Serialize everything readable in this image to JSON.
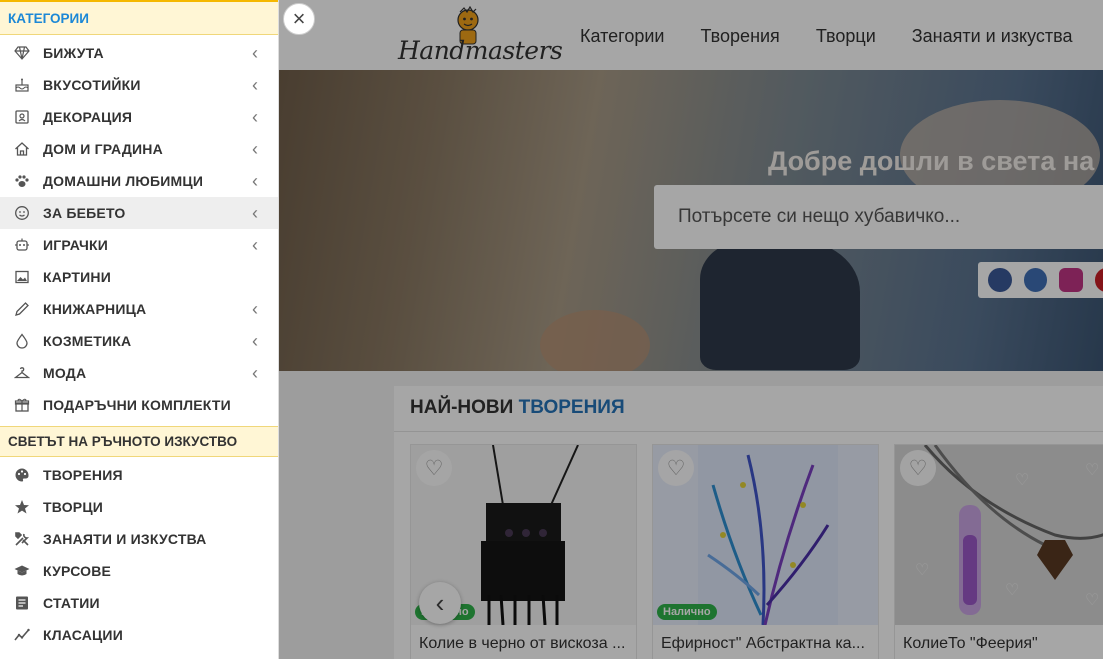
{
  "sidebar": {
    "categories_title": "КАТЕГОРИИ",
    "categories": [
      {
        "label": "БИЖУТА",
        "icon": "diamond-icon",
        "has_submenu": true
      },
      {
        "label": "ВКУСОТИЙКИ",
        "icon": "cake-icon",
        "has_submenu": true
      },
      {
        "label": "ДЕКОРАЦИЯ",
        "icon": "decor-frame-icon",
        "has_submenu": true
      },
      {
        "label": "ДОМ И ГРАДИНА",
        "icon": "home-icon",
        "has_submenu": true
      },
      {
        "label": "ДОМАШНИ ЛЮБИМЦИ",
        "icon": "paw-icon",
        "has_submenu": true
      },
      {
        "label": "ЗА БЕБЕТО",
        "icon": "baby-face-icon",
        "has_submenu": true,
        "highlighted": true
      },
      {
        "label": "ИГРАЧКИ",
        "icon": "robot-icon",
        "has_submenu": true
      },
      {
        "label": "КАРТИНИ",
        "icon": "picture-icon",
        "has_submenu": false
      },
      {
        "label": "КНИЖАРНИЦА",
        "icon": "pencil-icon",
        "has_submenu": true
      },
      {
        "label": "КОЗМЕТИКА",
        "icon": "drop-icon",
        "has_submenu": true
      },
      {
        "label": "МОДА",
        "icon": "hanger-icon",
        "has_submenu": true
      },
      {
        "label": "ПОДАРЪЧНИ КОМПЛЕКТИ",
        "icon": "gift-box-icon",
        "has_submenu": false
      }
    ],
    "world_title": "СВЕТЪТ НА РЪЧНОТО ИЗКУСТВО",
    "world": [
      {
        "label": "ТВОРЕНИЯ",
        "icon": "palette-icon"
      },
      {
        "label": "ТВОРЦИ",
        "icon": "star-icon"
      },
      {
        "label": "ЗАНАЯТИ И ИЗКУСТВА",
        "icon": "tools-icon"
      },
      {
        "label": "КУРСОВЕ",
        "icon": "graduation-cap-icon"
      },
      {
        "label": "СТАТИИ",
        "icon": "article-icon"
      },
      {
        "label": "КЛАСАЦИИ",
        "icon": "trend-chart-icon"
      }
    ]
  },
  "close_label": "×",
  "header": {
    "logo_text": "Handmasters",
    "nav": [
      "Категории",
      "Творения",
      "Творци",
      "Занаяти и изкуства"
    ]
  },
  "hero": {
    "title": "Добре дошли в света на р",
    "search_placeholder": "Потърсете си нещо хубавичко..."
  },
  "newest": {
    "title_plain": "НАЙ-НОВИ",
    "title_accent": "ТВОРЕНИЯ",
    "products": [
      {
        "name": "Колие в черно от вискоза ...",
        "badge": "Налично"
      },
      {
        "name": "Ефирност\" Абстрактна ка...",
        "badge": "Налично"
      },
      {
        "name": "КолиеТо \"Феерия\"",
        "badge": ""
      }
    ]
  },
  "colors": {
    "accent_blue": "#1c88d6",
    "highlight_yellow": "#fff6d5",
    "badge_green": "#2fb24a"
  }
}
